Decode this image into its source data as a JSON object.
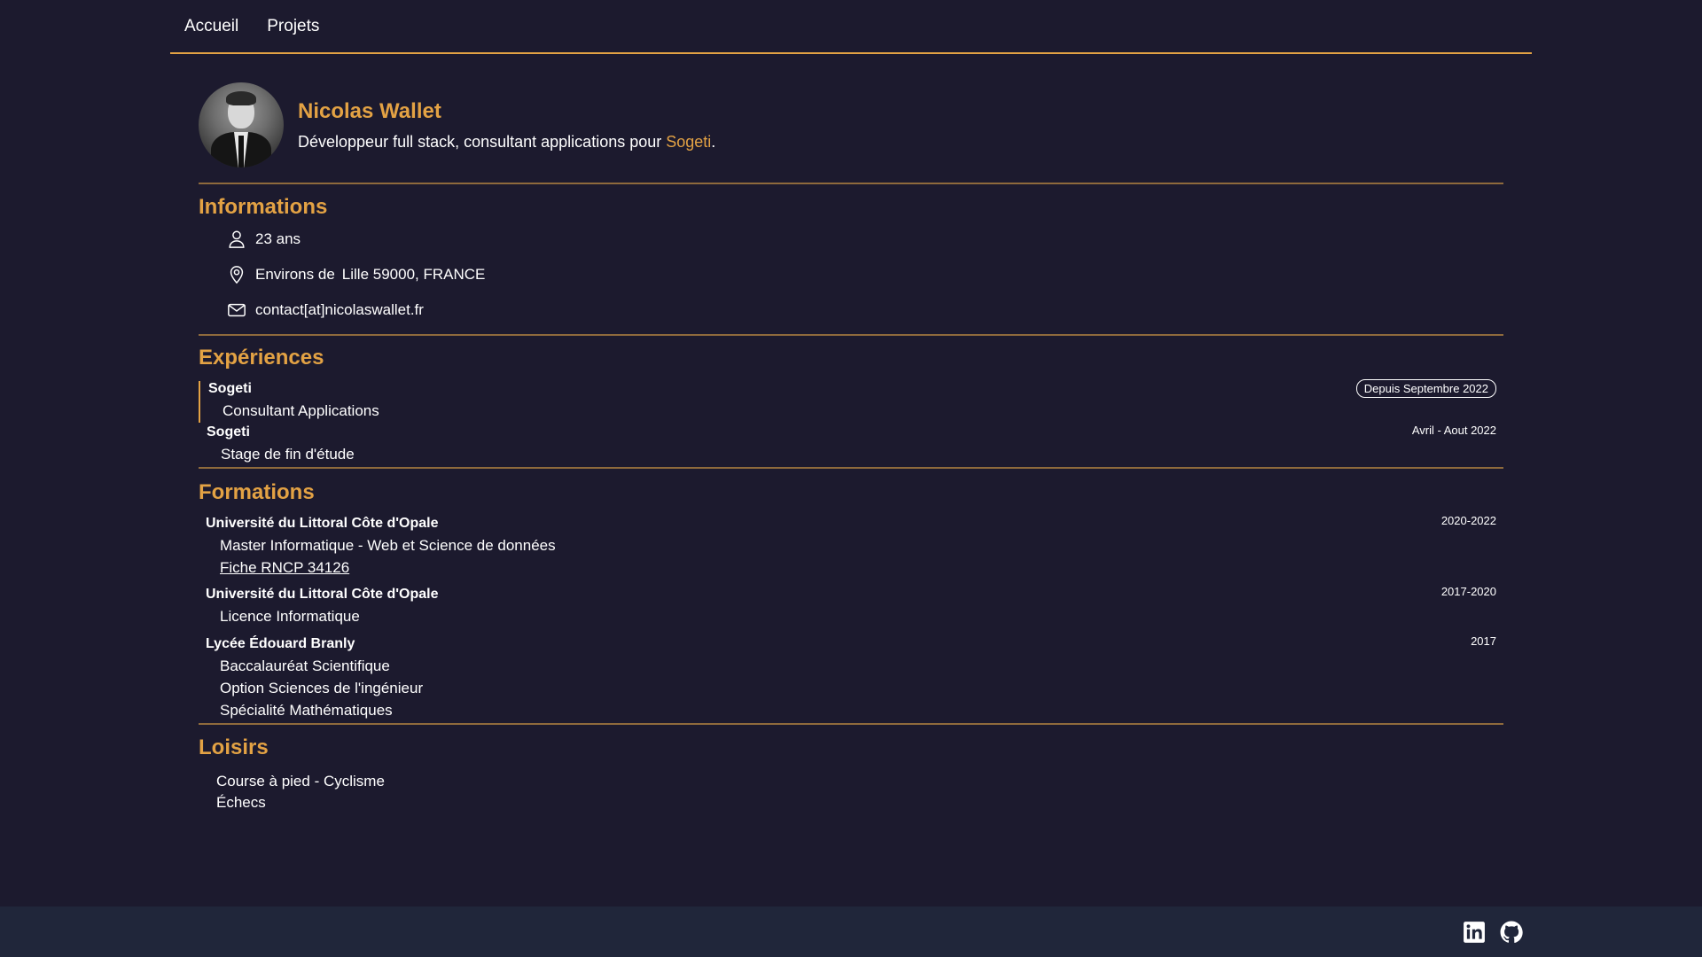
{
  "nav": {
    "items": [
      {
        "label": "Accueil"
      },
      {
        "label": "Projets"
      }
    ]
  },
  "profile": {
    "name": "Nicolas Wallet",
    "subtitle_prefix": "Développeur full stack, consultant applications pour ",
    "company": "Sogeti",
    "subtitle_suffix": "."
  },
  "informations": {
    "title": "Informations",
    "age": "23 ans",
    "location_label": "Environs de",
    "location": "Lille 59000, FRANCE",
    "email": "contact[at]nicolaswallet.fr"
  },
  "experiences": {
    "title": "Expériences",
    "items": [
      {
        "org": "Sogeti",
        "role": "Consultant Applications",
        "date": "Depuis Septembre 2022"
      },
      {
        "org": "Sogeti",
        "role": "Stage de fin d'étude",
        "date": "Avril - Aout 2022"
      }
    ]
  },
  "formations": {
    "title": "Formations",
    "items": [
      {
        "org": "Université du Littoral Côte d'Opale",
        "detail": "Master Informatique - Web et Science de données",
        "link": "Fiche RNCP 34126",
        "date": "2020-2022"
      },
      {
        "org": "Université du Littoral Côte d'Opale",
        "detail": "Licence Informatique",
        "date": "2017-2020"
      },
      {
        "org": "Lycée Édouard Branly",
        "details": [
          "Baccalauréat Scientifique",
          "Option Sciences de l'ingénieur",
          "Spécialité Mathématiques"
        ],
        "date": "2017"
      }
    ]
  },
  "loisirs": {
    "title": "Loisirs",
    "items": [
      "Course à pied - Cyclisme",
      "Échecs"
    ]
  },
  "footer": {
    "icons": [
      "linkedin-icon",
      "github-icon"
    ]
  },
  "colors": {
    "background": "#1c1a2e",
    "accent": "#e3a244",
    "footer": "#20263a"
  }
}
